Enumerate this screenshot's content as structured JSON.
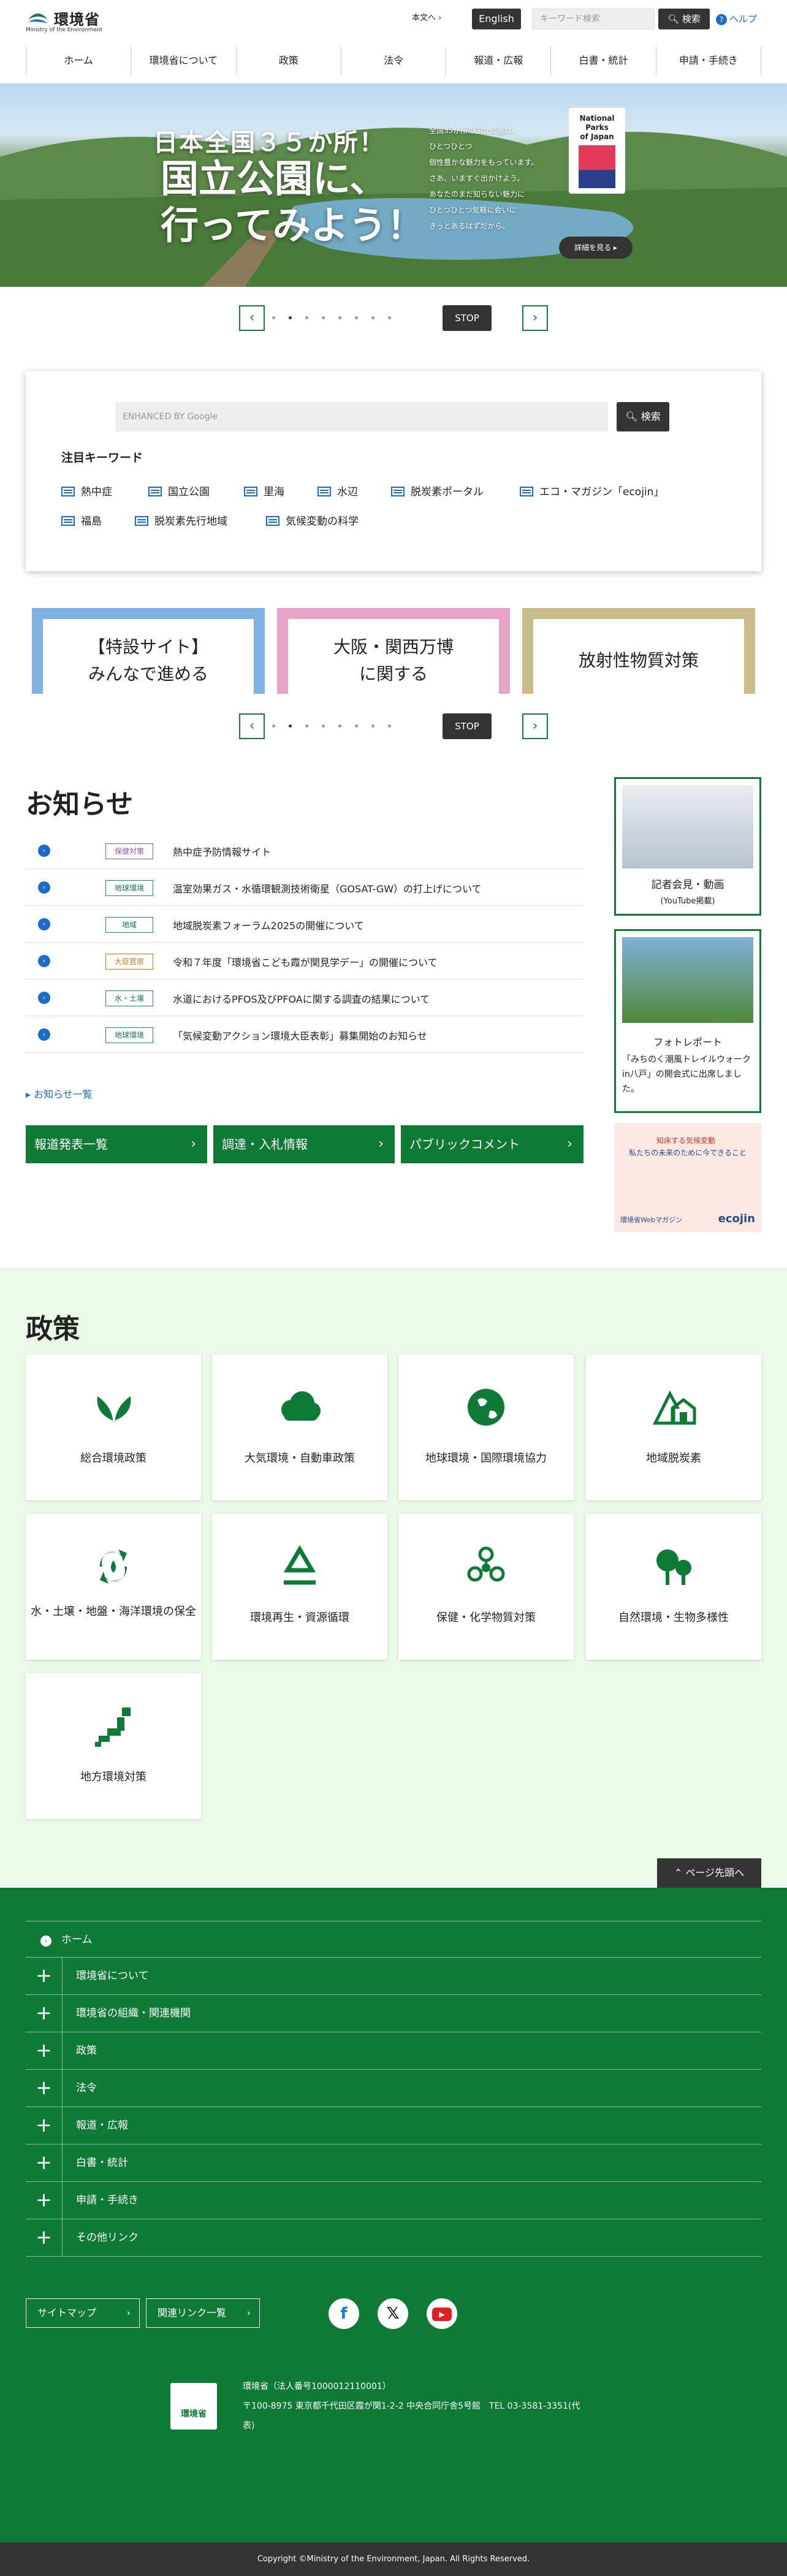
{
  "header": {
    "logo_jp": "環境省",
    "logo_en": "Ministry of the Environment",
    "skip_link": "本文へ",
    "english": "English",
    "keyword_placeholder": "キーワード検索",
    "search": "検索",
    "help": "ヘルプ"
  },
  "nav": [
    "ホーム",
    "環境省について",
    "政策",
    "法令",
    "報道・広報",
    "白書・統計",
    "申請・手続き"
  ],
  "hero": {
    "title1": "日本全国３５か所！",
    "title2a": "国立公園に、",
    "title2b": "行ってみよう！",
    "desc": [
      "全国35か所の国立公園は、",
      "ひとつひとつ",
      "個性豊かな魅力をもっています。",
      "",
      "さあ、いますぐ出かけよう。",
      "あなたのまだ知らない魅力に",
      "ひとつひとつ気軽に会いに",
      "きっとあるはずだから。"
    ],
    "badge": [
      "National",
      "Parks",
      "of Japan"
    ],
    "detail": "詳細を見る ▸"
  },
  "slider": {
    "stop": "STOP"
  },
  "search": {
    "placeholder": "ENHANCED BY Google",
    "button": "検索",
    "kw_title": "注目キーワード",
    "keywords": [
      "熱中症",
      "国立公園",
      "里海",
      "水辺",
      "脱炭素ポータル",
      "エコ・マガジン「ecojin」",
      "福島",
      "脱炭素先行地域",
      "気候変動の科学"
    ]
  },
  "banners": [
    {
      "line1": "【特設サイト】",
      "line2": "みんなで進める",
      "color": "#7fb2e0"
    },
    {
      "line1": "大阪・関西万博",
      "line2": "に関する",
      "color": "#e7a3c8"
    },
    {
      "line1": "放射性物質対策",
      "line2": "",
      "color": "#c9bc8c"
    }
  ],
  "news": {
    "heading": "お知らせ",
    "items": [
      {
        "tag": "保健対策",
        "text": "熱中症予防情報サイト",
        "tag_color": "#8a5aa8"
      },
      {
        "tag": "地球環境",
        "text": "温室効果ガス・水循環観測技術衛星（GOSAT-GW）の打上げについて",
        "tag_color": "#1a8a8a"
      },
      {
        "tag": "地域",
        "text": "地域脱炭素フォーラム2025の開催について",
        "tag_color": "#1a8a8a"
      },
      {
        "tag": "大臣官房",
        "text": "令和７年度「環境省こども霞が関見学デー」の開催について",
        "tag_color": "#c07a1a"
      },
      {
        "tag": "水・土壌",
        "text": "水道におけるPFOS及びPFOAに関する調査の結果について",
        "tag_color": "#1a8a8a"
      },
      {
        "tag": "地球環境",
        "text": "「気候変動アクション環境大臣表彰」募集開始のお知らせ",
        "tag_color": "#1a8a8a"
      }
    ],
    "list_link": "お知らせ一覧",
    "buttons": [
      "報道発表一覧",
      "調達・入札情報",
      "パブリックコメント"
    ]
  },
  "side": {
    "press": {
      "title": "記者会見・動画",
      "sub": "(YouTube掲載)"
    },
    "photo": {
      "title": "フォトレポート",
      "desc": "「みちのく潮風トレイルウォーク in八戸」の開会式に出席しました。"
    },
    "ecojin": {
      "line1": "知床する気候変動",
      "line2": "私たちの未来のために今できること",
      "footer": "環境省Webマガジン",
      "brand": "ecojin"
    }
  },
  "policy": {
    "heading": "政策",
    "items": [
      {
        "label": "総合環境政策",
        "icon": "leaf-icon"
      },
      {
        "label": "大気環境・自動車政策",
        "icon": "cloud-icon"
      },
      {
        "label": "地球環境・国際環境協力",
        "icon": "globe-icon"
      },
      {
        "label": "地域脱炭素",
        "icon": "house-icon"
      },
      {
        "label": "水・土壌・地盤・海洋環境の保全",
        "icon": "water-cycle-icon"
      },
      {
        "label": "環境再生・資源循環",
        "icon": "recycle-icon"
      },
      {
        "label": "保健・化学物質対策",
        "icon": "molecule-icon"
      },
      {
        "label": "自然環境・生物多様性",
        "icon": "tree-icon"
      },
      {
        "label": "地方環境対策",
        "icon": "japan-map-icon"
      }
    ],
    "back_to_top": "ページ先頭へ"
  },
  "footer": {
    "home": "ホーム",
    "rows": [
      "環境省について",
      "環境省の組織・関連機関",
      "政策",
      "法令",
      "報道・広報",
      "白書・統計",
      "申請・手続き",
      "その他リンク"
    ],
    "sitemap": "サイトマップ",
    "links": "関連リンク一覧",
    "logo": "環境省",
    "addr1": "環境省（法人番号1000012110001）",
    "addr2": "〒100-8975 東京都千代田区霞が関1-2-2 中央合同庁舎5号館　TEL 03-3581-3351(代",
    "addr3": "表)",
    "copyright": "Copyright ©Ministry of the Environment, Japan. All Rights Reserved."
  }
}
